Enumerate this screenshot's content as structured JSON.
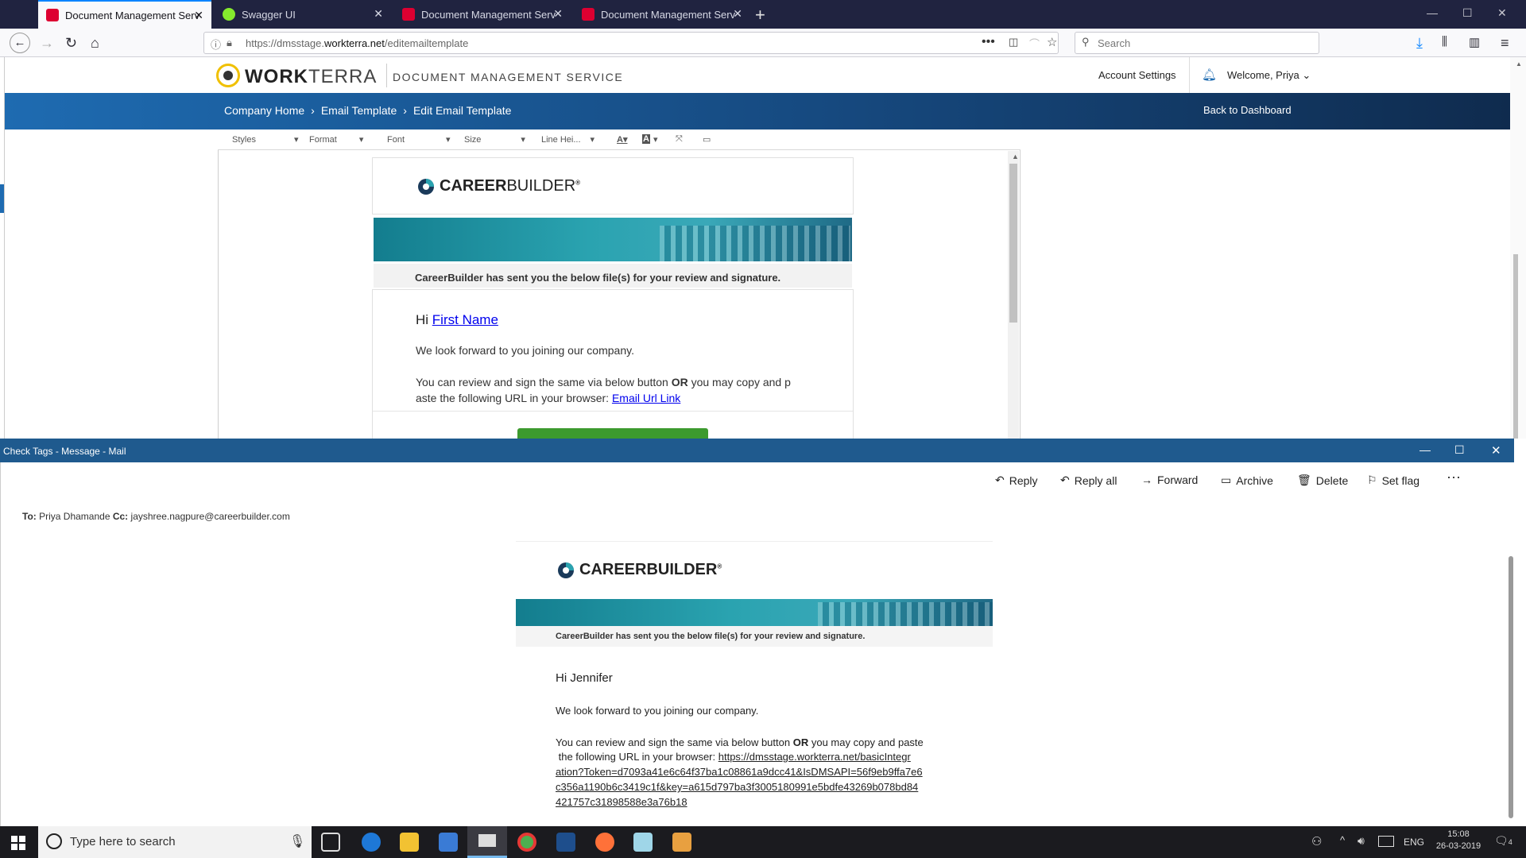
{
  "browser": {
    "tabs": [
      {
        "label": "Document Management Servic",
        "icon": "angular-icon",
        "color": "#dd0031",
        "active": true
      },
      {
        "label": "Swagger UI",
        "icon": "swagger-icon",
        "color": "#85ea2d",
        "active": false
      },
      {
        "label": "Document Management Servic",
        "icon": "angular-icon",
        "color": "#dd0031",
        "active": false
      },
      {
        "label": "Document Management Servic",
        "icon": "angular-icon",
        "color": "#dd0031",
        "active": false
      }
    ],
    "url_prefix": "https://dmsstage.",
    "url_domain": "workterra.net",
    "url_path": "/editemailtemplate",
    "search_placeholder": "Search"
  },
  "app": {
    "logo_bold": "WORK",
    "logo_light": "TERRA",
    "service_title": "DOCUMENT MANAGEMENT SERVICE",
    "account_settings": "Account Settings",
    "welcome": "Welcome, Priya",
    "breadcrumb": [
      "Company Home",
      "Email Template",
      "Edit Email Template"
    ],
    "back_to_dashboard": "Back to Dashboard",
    "toolbar": {
      "styles": "Styles",
      "format": "Format",
      "font": "Font",
      "size": "Size",
      "line_height": "Line Hei..."
    }
  },
  "template": {
    "brand_bold": "CAREER",
    "brand_light": "BUILDER",
    "reg_mark": "®",
    "notice": "CareerBuilder has sent you the below file(s) for your review and signature.",
    "greeting": "Hi",
    "first_name": "First Name",
    "line1": "We look forward to you joining our company.",
    "line2a": "You can review and sign the same via below button",
    "line2b": "OR",
    "line2c": "you may copy and p",
    "line3": "aste the following URL in your browser:",
    "link": "Email Url Link"
  },
  "mail": {
    "window_title": "Check Tags - Message - Mail",
    "actions": [
      "Reply",
      "Reply all",
      "Forward",
      "Archive",
      "Delete",
      "Set flag"
    ],
    "to_label": "To:",
    "to_value": "Priya Dhamande",
    "cc_label": "Cc:",
    "cc_value": "jayshree.nagpure@careerbuilder.com",
    "greeting": "Hi Jennifer",
    "line1": "We look forward to you joining our company.",
    "line2a": "You can review and sign the same via below button",
    "line2b": "OR",
    "line2c": "you may copy and paste",
    "line3": "the following URL in your browser:",
    "url_lines": [
      "https://dmsstage.workterra.net/basicIntegr",
      "ation?Token=d7093a41e6c64f37ba1c08861a9dcc41&IsDMSAPI=56f9eb9ffa7e6",
      "c356a1190b6c3419c1f&key=a615d797ba3f3005180991e5bdfe43269b078bd84",
      "421757c31898588e3a76b18"
    ]
  },
  "taskbar": {
    "search_placeholder": "Type here to search",
    "lang": "ENG",
    "time": "15:08",
    "date": "26-03-2019",
    "notif_count": "4"
  }
}
